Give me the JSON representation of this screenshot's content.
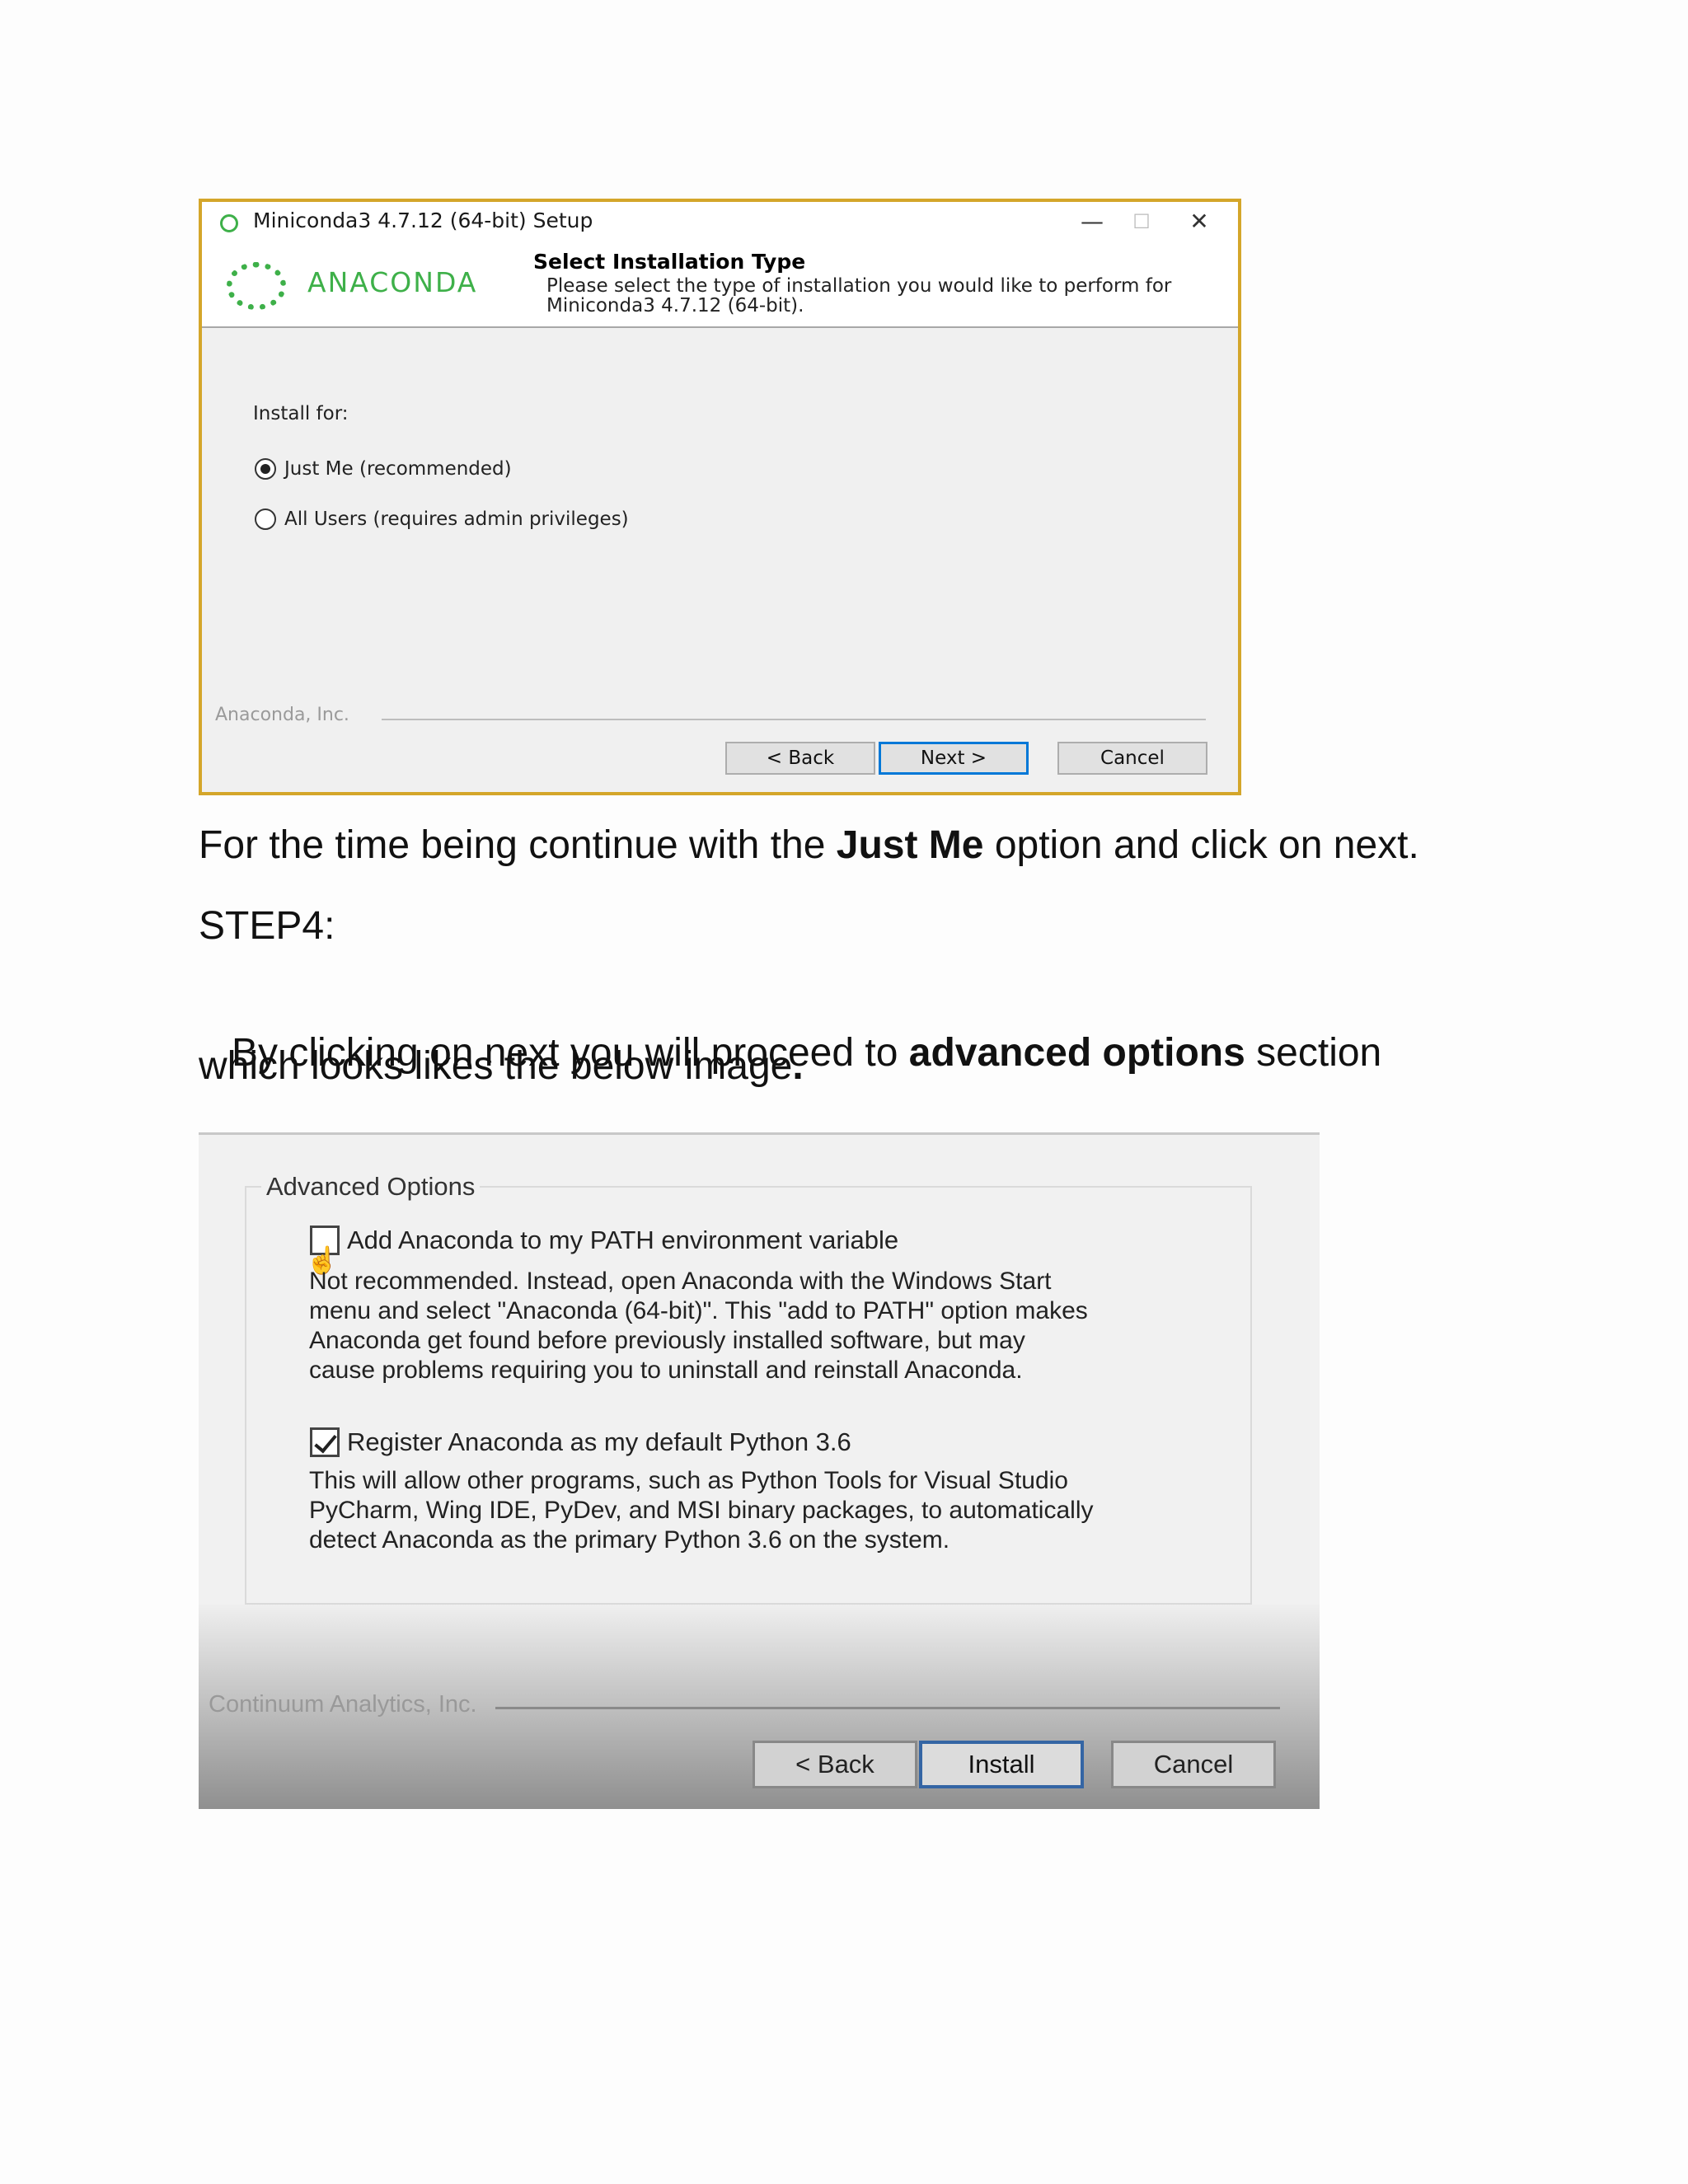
{
  "window1": {
    "title": "Miniconda3 4.7.12 (64-bit) Setup",
    "minimize_glyph": "—",
    "maximize_glyph": "☐",
    "close_glyph": "✕",
    "logo_text": "ANACONDA",
    "header_title": "Select Installation Type",
    "header_subtitle": "Please select the type of installation you would like to perform for Miniconda3 4.7.12 (64-bit).",
    "install_for_label": "Install for:",
    "options": [
      {
        "label": "Just Me (recommended)",
        "selected": true
      },
      {
        "label": "All Users (requires admin privileges)",
        "selected": false
      }
    ],
    "brand": "Anaconda, Inc.",
    "back_label": "< Back",
    "next_label": "Next >",
    "cancel_label": "Cancel",
    "icons": {
      "title": "anaconda-ring-icon",
      "logo": "anaconda-logo-icon"
    },
    "colors": {
      "frame": "#d4a62a",
      "brand_green": "#3eb049",
      "focus_blue": "#0078d7"
    }
  },
  "doc": {
    "para1_before": "For the time being continue with the ",
    "para1_bold": "Just Me",
    "para1_after": " option and click on next.",
    "step_label": "STEP4:",
    "para2_line1_before": " By clicking on next you will proceed to ",
    "para2_line1_bold": "advanced options",
    "para2_line1_after": " section",
    "para2_line2": "which looks likes the below image",
    "para2_line2_bold": "."
  },
  "window2": {
    "group_label": "Advanced Options",
    "option1_label": "Add Anaconda to my PATH environment variable",
    "option1_checked": false,
    "option1_desc": "Not recommended. Instead, open Anaconda with the Windows Start\nmenu and select \"Anaconda (64-bit)\". This \"add to PATH\" option makes\nAnaconda get found before previously installed software, but may\ncause problems requiring you to uninstall and reinstall Anaconda.",
    "option2_label": "Register Anaconda as my default Python 3.6",
    "option2_checked": true,
    "option2_desc": "This will allow other programs, such as Python Tools for Visual Studio\nPyCharm, Wing IDE, PyDev, and MSI binary packages, to automatically\ndetect Anaconda as the primary Python 3.6 on the system.",
    "brand": "Continuum Analytics, Inc.",
    "back_label": "< Back",
    "install_label": "Install",
    "cancel_label": "Cancel",
    "cursor_glyph": "☝"
  }
}
